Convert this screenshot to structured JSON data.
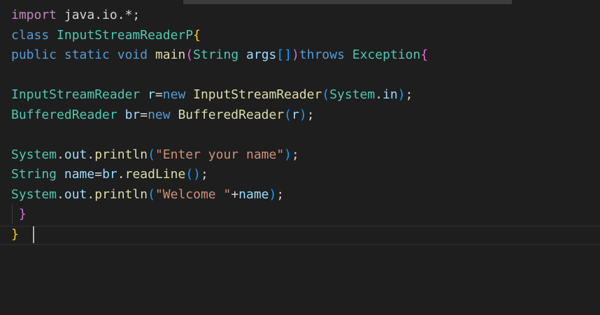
{
  "editor": {
    "lines": [
      [
        {
          "t": "import",
          "c": "kw-ctrl"
        },
        {
          "t": " java.io.*;",
          "c": "plain"
        }
      ],
      [
        {
          "t": "class ",
          "c": "kw"
        },
        {
          "t": "InputStreamReaderP",
          "c": "type"
        },
        {
          "t": "{",
          "c": "br1"
        }
      ],
      [
        {
          "t": "public",
          "c": "kw"
        },
        {
          "t": " ",
          "c": "plain"
        },
        {
          "t": "static",
          "c": "kw"
        },
        {
          "t": " ",
          "c": "plain"
        },
        {
          "t": "void",
          "c": "kw"
        },
        {
          "t": " ",
          "c": "plain"
        },
        {
          "t": "main",
          "c": "fn"
        },
        {
          "t": "(",
          "c": "br2"
        },
        {
          "t": "String",
          "c": "type"
        },
        {
          "t": " ",
          "c": "plain"
        },
        {
          "t": "args",
          "c": "var"
        },
        {
          "t": "[]",
          "c": "br3"
        },
        {
          "t": ")",
          "c": "br2"
        },
        {
          "t": "throws",
          "c": "kw"
        },
        {
          "t": " ",
          "c": "plain"
        },
        {
          "t": "Exception",
          "c": "type"
        },
        {
          "t": "{",
          "c": "br2"
        }
      ],
      [],
      [
        {
          "t": "InputStreamReader",
          "c": "type"
        },
        {
          "t": " ",
          "c": "plain"
        },
        {
          "t": "r",
          "c": "var"
        },
        {
          "t": "=",
          "c": "plain"
        },
        {
          "t": "new",
          "c": "kw"
        },
        {
          "t": " ",
          "c": "plain"
        },
        {
          "t": "InputStreamReader",
          "c": "fn"
        },
        {
          "t": "(",
          "c": "br3"
        },
        {
          "t": "System",
          "c": "type"
        },
        {
          "t": ".",
          "c": "plain"
        },
        {
          "t": "in",
          "c": "var"
        },
        {
          "t": ")",
          "c": "br3"
        },
        {
          "t": ";",
          "c": "plain"
        }
      ],
      [
        {
          "t": "BufferedReader",
          "c": "type"
        },
        {
          "t": " ",
          "c": "plain"
        },
        {
          "t": "br",
          "c": "var"
        },
        {
          "t": "=",
          "c": "plain"
        },
        {
          "t": "new",
          "c": "kw"
        },
        {
          "t": " ",
          "c": "plain"
        },
        {
          "t": "BufferedReader",
          "c": "fn"
        },
        {
          "t": "(",
          "c": "br3"
        },
        {
          "t": "r",
          "c": "var"
        },
        {
          "t": ")",
          "c": "br3"
        },
        {
          "t": ";",
          "c": "plain"
        }
      ],
      [],
      [
        {
          "t": "System",
          "c": "type"
        },
        {
          "t": ".",
          "c": "plain"
        },
        {
          "t": "out",
          "c": "var"
        },
        {
          "t": ".",
          "c": "plain"
        },
        {
          "t": "println",
          "c": "fn"
        },
        {
          "t": "(",
          "c": "br3"
        },
        {
          "t": "\"Enter your name\"",
          "c": "str"
        },
        {
          "t": ")",
          "c": "br3"
        },
        {
          "t": ";",
          "c": "plain"
        }
      ],
      [
        {
          "t": "String",
          "c": "type"
        },
        {
          "t": " ",
          "c": "plain"
        },
        {
          "t": "name",
          "c": "var"
        },
        {
          "t": "=",
          "c": "plain"
        },
        {
          "t": "br",
          "c": "var"
        },
        {
          "t": ".",
          "c": "plain"
        },
        {
          "t": "readLine",
          "c": "fn"
        },
        {
          "t": "()",
          "c": "br3"
        },
        {
          "t": ";",
          "c": "plain"
        }
      ],
      [
        {
          "t": "System",
          "c": "type"
        },
        {
          "t": ".",
          "c": "plain"
        },
        {
          "t": "out",
          "c": "var"
        },
        {
          "t": ".",
          "c": "plain"
        },
        {
          "t": "println",
          "c": "fn"
        },
        {
          "t": "(",
          "c": "br3"
        },
        {
          "t": "\"Welcome \"",
          "c": "str"
        },
        {
          "t": "+",
          "c": "plain"
        },
        {
          "t": "name",
          "c": "var"
        },
        {
          "t": ")",
          "c": "br3"
        },
        {
          "t": ";",
          "c": "plain"
        }
      ],
      [
        {
          "t": " ",
          "c": "plain"
        },
        {
          "t": "}",
          "c": "br2"
        }
      ],
      [
        {
          "t": "}",
          "c": "br1"
        }
      ]
    ]
  },
  "colors": {
    "background": "#1e1e1e",
    "keyword": "#569cd6",
    "control_keyword": "#c586c0",
    "type": "#4ec9b0",
    "function": "#dcdcaa",
    "variable": "#9cdcfe",
    "string": "#ce9178",
    "bracket_gold": "#ffd700",
    "bracket_purple": "#da70d6",
    "bracket_blue": "#179fff"
  }
}
